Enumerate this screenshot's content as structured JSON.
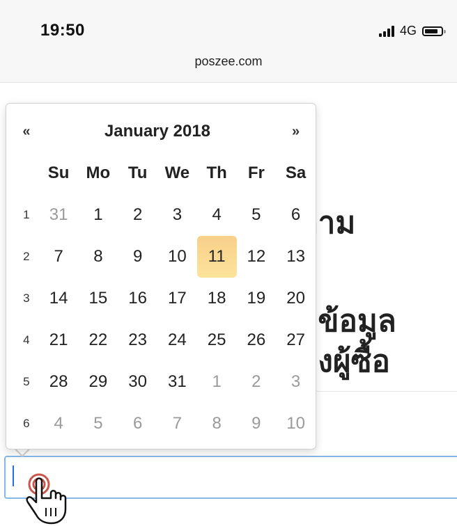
{
  "status_bar": {
    "time": "19:50",
    "network": "4G"
  },
  "browser": {
    "url": "poszee.com"
  },
  "page": {
    "heading_fragment_1": "ถาม",
    "heading_fragment_2": "อข้อมูล",
    "heading_fragment_3": "องผู้ซื้อ"
  },
  "datepicker": {
    "prev_label": "«",
    "next_label": "»",
    "month_title": "January 2018",
    "weekdays": [
      "Su",
      "Mo",
      "Tu",
      "We",
      "Th",
      "Fr",
      "Sa"
    ],
    "weeks": [
      {
        "week": "1",
        "days": [
          "31",
          "1",
          "2",
          "3",
          "4",
          "5",
          "6"
        ]
      },
      {
        "week": "2",
        "days": [
          "7",
          "8",
          "9",
          "10",
          "11",
          "12",
          "13"
        ]
      },
      {
        "week": "3",
        "days": [
          "14",
          "15",
          "16",
          "17",
          "18",
          "19",
          "20"
        ]
      },
      {
        "week": "4",
        "days": [
          "21",
          "22",
          "23",
          "24",
          "25",
          "26",
          "27"
        ]
      },
      {
        "week": "5",
        "days": [
          "28",
          "29",
          "30",
          "31",
          "1",
          "2",
          "3"
        ]
      },
      {
        "week": "6",
        "days": [
          "4",
          "5",
          "6",
          "7",
          "8",
          "9",
          "10"
        ]
      }
    ],
    "today": "11",
    "today_color": "#fbd88f",
    "muted_color": "#9a9a9a"
  },
  "icons": {
    "cursor": "hand-pointer-icon",
    "signal": "signal-bars-icon",
    "battery": "battery-icon"
  },
  "colors": {
    "input_border": "#86b7e8",
    "caret": "#2f6be0",
    "touch_ring": "#c0392b"
  }
}
